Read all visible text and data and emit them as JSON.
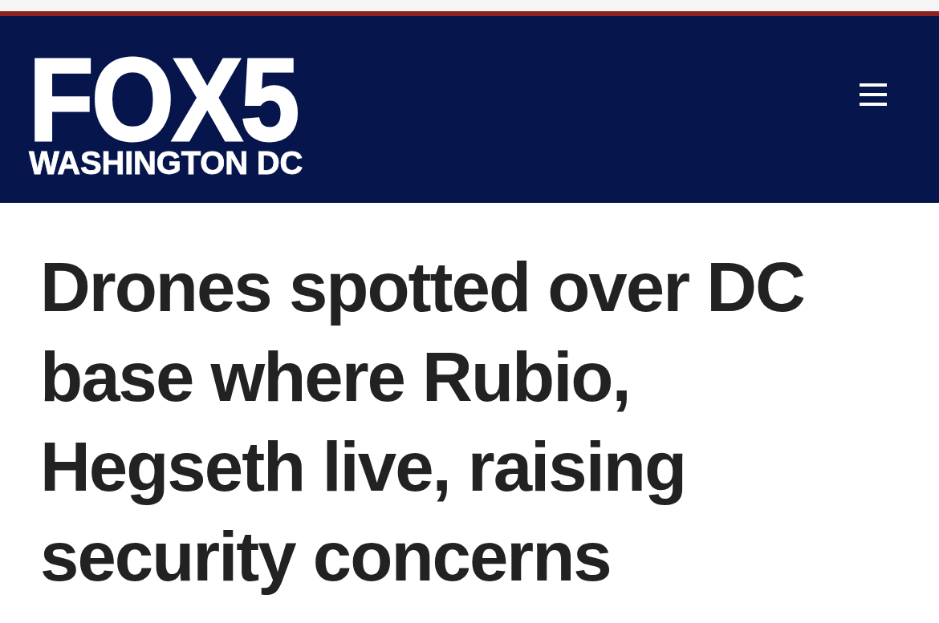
{
  "header": {
    "logo": {
      "wordmark": "FOX5",
      "tagline": "WASHINGTON DC"
    }
  },
  "article": {
    "headline": "Drones spotted over DC base where Rubio, Hegseth live, raising security concerns"
  }
}
